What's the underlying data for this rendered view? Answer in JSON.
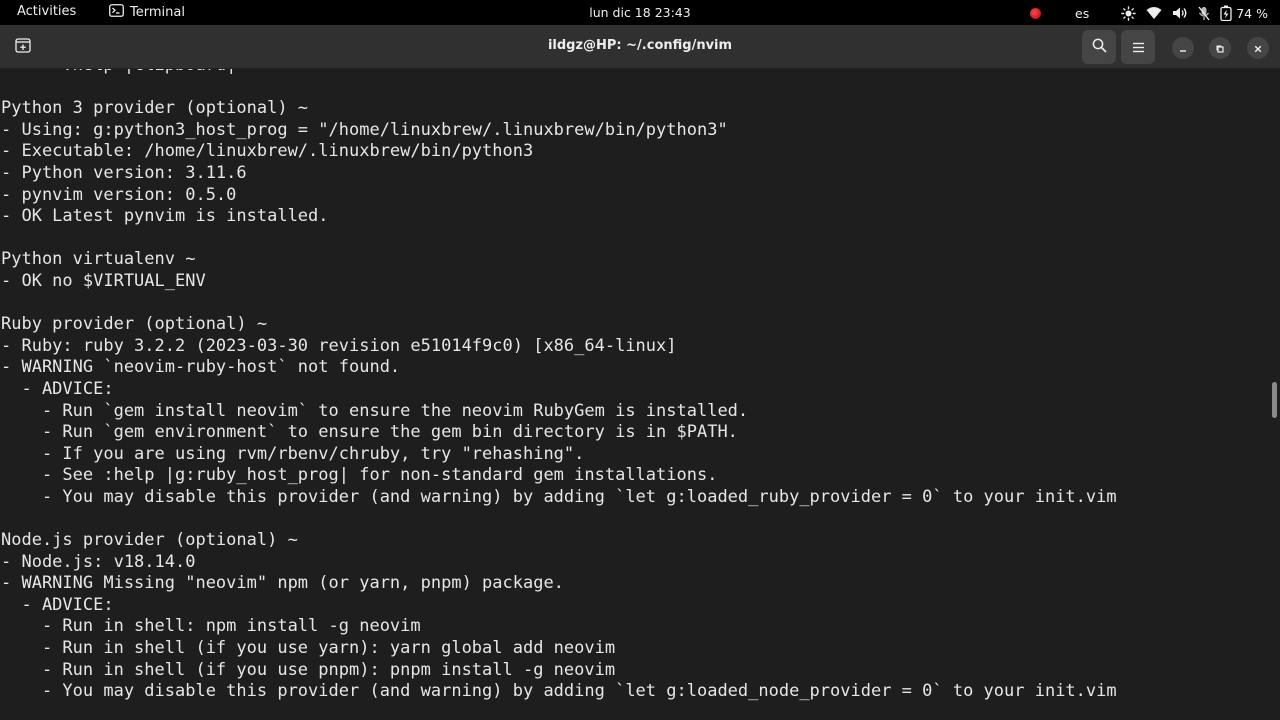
{
  "topbar": {
    "activities": "Activities",
    "app_name": "Terminal",
    "clock": "lun dic 18  23:43",
    "keyboard_layout": "es",
    "battery_percent": "74 %"
  },
  "window": {
    "title": "ildgz@HP: ~/.config/nvim"
  },
  "terminal": {
    "lines": [
      "    - :help |clipboard|",
      "",
      "Python 3 provider (optional) ~",
      "- Using: g:python3_host_prog = \"/home/linuxbrew/.linuxbrew/bin/python3\"",
      "- Executable: /home/linuxbrew/.linuxbrew/bin/python3",
      "- Python version: 3.11.6",
      "- pynvim version: 0.5.0",
      "- OK Latest pynvim is installed.",
      "",
      "Python virtualenv ~",
      "- OK no $VIRTUAL_ENV",
      "",
      "Ruby provider (optional) ~",
      "- Ruby: ruby 3.2.2 (2023-03-30 revision e51014f9c0) [x86_64-linux]",
      "- WARNING `neovim-ruby-host` not found.",
      "  - ADVICE:",
      "    - Run `gem install neovim` to ensure the neovim RubyGem is installed.",
      "    - Run `gem environment` to ensure the gem bin directory is in $PATH.",
      "    - If you are using rvm/rbenv/chruby, try \"rehashing\".",
      "    - See :help |g:ruby_host_prog| for non-standard gem installations.",
      "    - You may disable this provider (and warning) by adding `let g:loaded_ruby_provider = 0` to your init.vim",
      "",
      "Node.js provider (optional) ~",
      "- Node.js: v18.14.0",
      "- WARNING Missing \"neovim\" npm (or yarn, pnpm) package.",
      "  - ADVICE:",
      "    - Run in shell: npm install -g neovim",
      "    - Run in shell (if you use yarn): yarn global add neovim",
      "    - Run in shell (if you use pnpm): pnpm install -g neovim",
      "    - You may disable this provider (and warning) by adding `let g:loaded_node_provider = 0` to your init.vim"
    ]
  },
  "colors": {
    "terminal_bg": "#1e1e1e",
    "terminal_fg": "#e6e6e6",
    "headerbar_bg": "#303030",
    "topbar_bg": "#000000",
    "record_indicator": "#e01b24"
  },
  "icons": {
    "app": "terminal-icon",
    "new_tab": "new-tab-icon",
    "search": "search-icon",
    "menu": "hamburger-menu-icon",
    "minimize": "minimize-icon",
    "maximize": "maximize-icon",
    "close": "close-icon",
    "brightness": "brightness-icon",
    "wifi": "wifi-icon",
    "volume": "volume-icon",
    "microphone": "microphone-muted-icon",
    "battery": "battery-charging-icon"
  }
}
